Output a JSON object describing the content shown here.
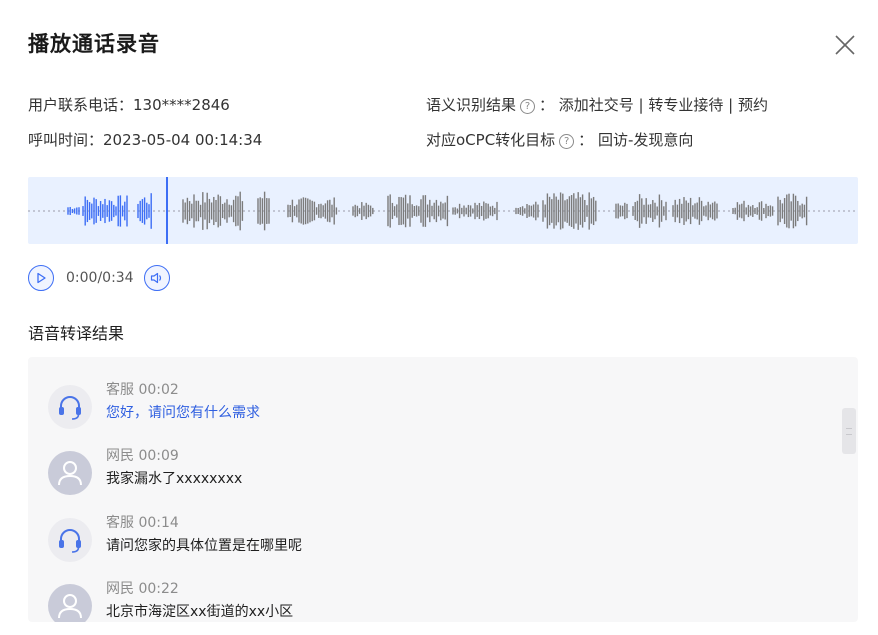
{
  "dialog": {
    "title": "播放通话录音"
  },
  "info": {
    "phone_label": "用户联系电话：",
    "phone_value": "130****2846",
    "time_label": "呼叫时间：",
    "time_value": "2023-05-04 00:14:34",
    "semantic_label": "语义识别结果",
    "semantic_value": "：  添加社交号 | 转专业接待 | 预约",
    "ocpc_label": "对应oCPC转化目标",
    "ocpc_value": "：  回访-发现意向",
    "help_glyph": "?"
  },
  "player": {
    "time_text": "0:00/0:34",
    "accent_color": "#3d6ef5",
    "wave_color": "#7b7b7b",
    "icons": [
      "play-icon",
      "volume-icon"
    ]
  },
  "transcript": {
    "section_title": "语音转译结果",
    "messages": [
      {
        "role": "客服",
        "time": "00:02",
        "text": "您好，请问您有什么需求",
        "avatar": "headset-icon"
      },
      {
        "role": "网民",
        "time": "00:09",
        "text": "我家漏水了xxxxxxxx",
        "avatar": "user-icon"
      },
      {
        "role": "客服",
        "time": "00:14",
        "text": "请问您家的具体位置是在哪里呢",
        "avatar": "headset-icon"
      },
      {
        "role": "网民",
        "time": "00:22",
        "text": "北京市海淀区xx街道的xx小区",
        "avatar": "user-icon"
      }
    ]
  }
}
